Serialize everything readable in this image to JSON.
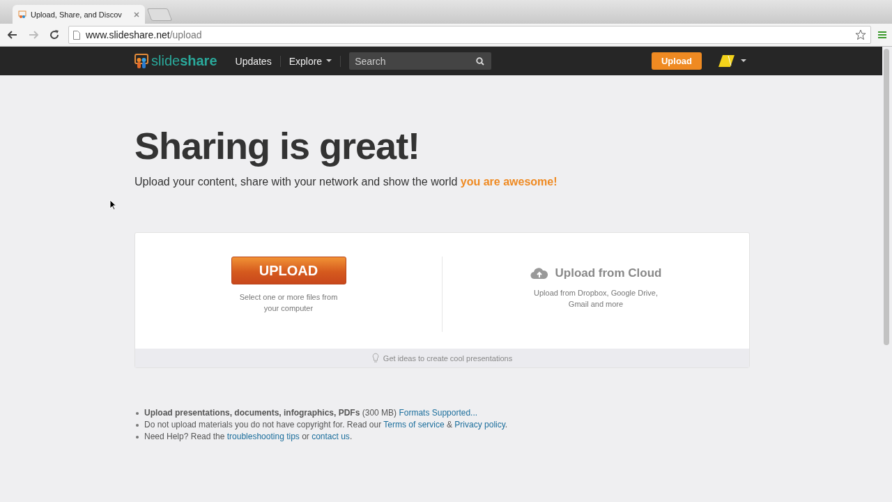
{
  "browser": {
    "tab": {
      "title": "Upload, Share, and Discov",
      "selected": true
    },
    "url_host": "www.slideshare.net",
    "url_path": "/upload"
  },
  "navbar": {
    "logo": "slide**share**",
    "links": [
      {
        "label": "Updates",
        "dropdown": false
      },
      {
        "label": "Explore",
        "dropdown": true
      }
    ],
    "search": {
      "placeholder": "Search"
    },
    "upload_button": "Upload"
  },
  "hero": {
    "title": "Sharing is great!",
    "subtitle": "Upload your content, share with your network and show the world",
    "highlight": "you are awesome!"
  },
  "upload_card": {
    "local": {
      "button": "UPLOAD",
      "caption": "Select one or more files from your computer"
    },
    "cloud": {
      "title": "Upload from Cloud",
      "caption": "Upload from Dropbox, Google Drive, Gmail and more"
    },
    "footer": "Get ideas to create cool presentations"
  },
  "notes": [
    [
      {
        "kind": "bold",
        "text": "Upload presentations, documents, infographics, PDFs"
      },
      {
        "kind": "text",
        "text": " (300 MB) "
      },
      {
        "kind": "link",
        "text": "Formats Supported..."
      }
    ],
    [
      {
        "kind": "text",
        "text": "Do not upload materials you do not have copyright for. Read our "
      },
      {
        "kind": "link",
        "text": "Terms of service"
      },
      {
        "kind": "text",
        "text": " & "
      },
      {
        "kind": "link",
        "text": "Privacy policy"
      },
      {
        "kind": "text",
        "text": "."
      }
    ],
    [
      {
        "kind": "text",
        "text": "Need Help? Read the "
      },
      {
        "kind": "link",
        "text": "troubleshooting tips"
      },
      {
        "kind": "text",
        "text": " or "
      },
      {
        "kind": "link",
        "text": "contact us"
      },
      {
        "kind": "text",
        "text": "."
      }
    ]
  ]
}
